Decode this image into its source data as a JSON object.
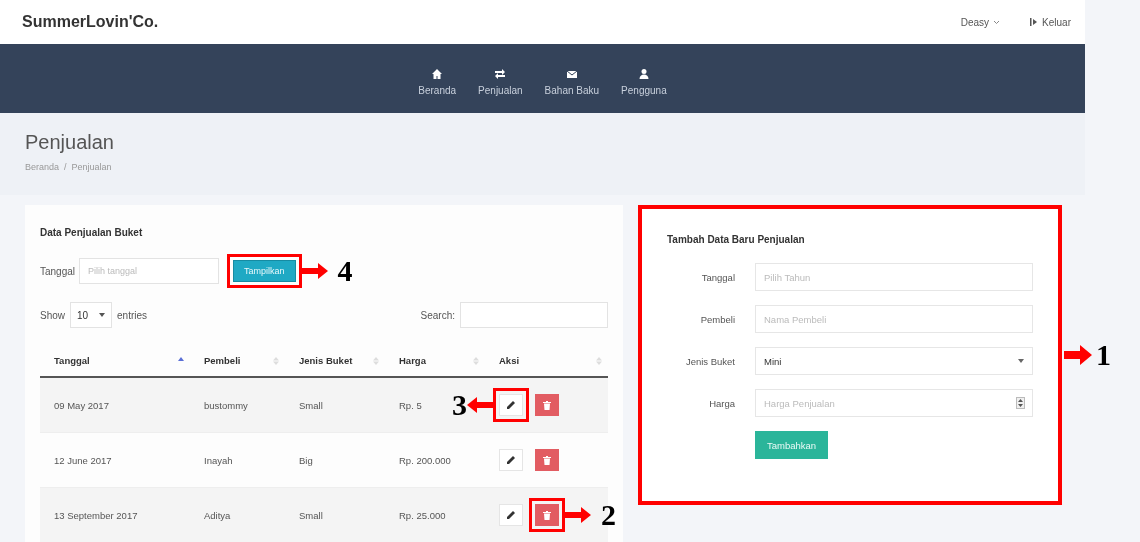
{
  "brand": "SummerLovin'Co.",
  "user_menu": {
    "label": "Deasy",
    "logout": "Keluar"
  },
  "nav": [
    {
      "label": "Beranda"
    },
    {
      "label": "Penjualan"
    },
    {
      "label": "Bahan Baku"
    },
    {
      "label": "Pengguna"
    }
  ],
  "page": {
    "title": "Penjualan",
    "breadcrumb": [
      "Beranda",
      "Penjualan"
    ],
    "breadcrumb_separator": "/"
  },
  "sales_panel": {
    "title": "Data Penjualan Buket",
    "filter": {
      "label": "Tanggal",
      "placeholder": "Pilih tanggal",
      "button": "Tampilkan",
      "callout": "4"
    },
    "length": {
      "show": "Show",
      "value": "10",
      "entries": "entries"
    },
    "search": {
      "label": "Search:"
    },
    "columns": [
      {
        "label": "Tanggal",
        "sorted": true
      },
      {
        "label": "Pembeli",
        "sorted": false
      },
      {
        "label": "Jenis Buket",
        "sorted": false
      },
      {
        "label": "Harga",
        "sorted": false
      },
      {
        "label": "Aksi",
        "sorted": false
      }
    ],
    "rows": [
      {
        "cells": [
          "09 May 2017",
          "bustommy",
          "Small",
          "Rp. 5"
        ],
        "edit_callout": "3"
      },
      {
        "cells": [
          "12 June 2017",
          "Inayah",
          "Big",
          "Rp. 200.000"
        ]
      },
      {
        "cells": [
          "13 September 2017",
          "Aditya",
          "Small",
          "Rp. 25.000"
        ],
        "delete_callout": "2"
      }
    ]
  },
  "form_panel": {
    "title": "Tambah Data Baru Penjualan",
    "callout": "1",
    "fields": [
      {
        "label": "Tanggal",
        "kind": "text",
        "placeholder": "Pilih Tahun"
      },
      {
        "label": "Pembeli",
        "kind": "text",
        "placeholder": "Nama Pembeli"
      },
      {
        "label": "Jenis Buket",
        "kind": "select",
        "value": "Mini"
      },
      {
        "label": "Harga",
        "kind": "number",
        "placeholder": "Harga Penjualan"
      }
    ],
    "submit": "Tambahkan"
  }
}
